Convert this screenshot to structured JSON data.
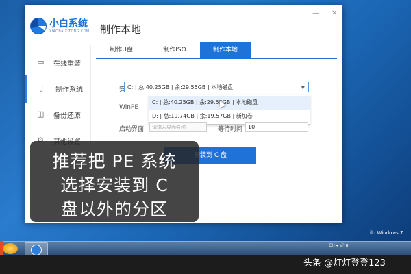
{
  "window": {
    "brand_name": "小白系统",
    "brand_sub": "XIAOBAIXITONG.COM",
    "page_title": "制作本地",
    "minimize": "—",
    "close": "✕"
  },
  "sidebar": {
    "items": [
      {
        "label": "在线重装",
        "icon": "monitor-icon"
      },
      {
        "label": "制作系统",
        "icon": "usb-icon"
      },
      {
        "label": "备份还原",
        "icon": "backup-icon"
      },
      {
        "label": "其他设置",
        "icon": "settings-icon"
      }
    ]
  },
  "tabs": [
    {
      "label": "制作U盘"
    },
    {
      "label": "制作ISO"
    },
    {
      "label": "制作本地"
    }
  ],
  "form": {
    "install_path_label": "安装路径",
    "install_path_value": "C: | 总:40.25GB | 余:29.55GB | 本地磁盘",
    "winpe_label": "WinPE",
    "boot_label": "启动界面",
    "boot_placeholder": "请输入界面名称",
    "wait_label": "等待时间",
    "wait_value": "10",
    "install_button": "安装到 C 盘"
  },
  "dropdown": {
    "options": [
      "C: | 总:40.25GB | 余:29.55GB | 本地磁盘",
      "D: | 总:19.74GB | 余:19.57GB | 新加卷"
    ]
  },
  "caption": {
    "lines": [
      "推荐把 PE 系统",
      "选择安装到 C",
      "盘以外的分区"
    ]
  },
  "taskbar": {
    "tray_text": "CH ◂ 🔊 ▮",
    "windows_version": "ild Windows 7"
  },
  "watermark": "头条 @灯灯登登123",
  "colors": {
    "accent": "#1f73d8"
  }
}
